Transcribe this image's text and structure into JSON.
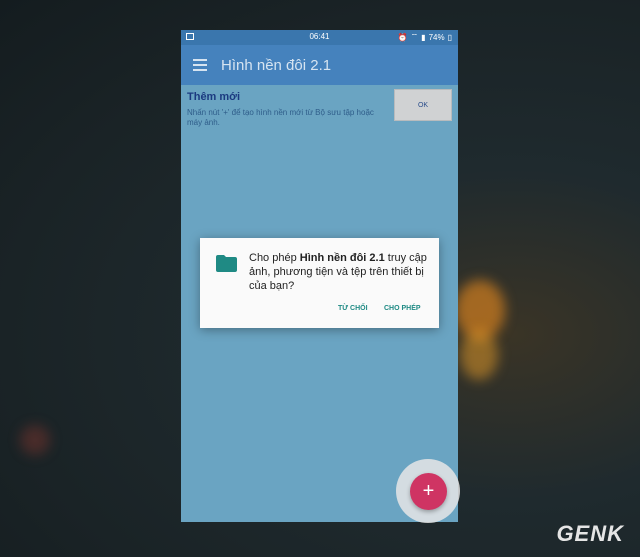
{
  "status_bar": {
    "time": "06:41",
    "battery": "74%"
  },
  "app_bar": {
    "title": "Hình nền đôi 2.1"
  },
  "content": {
    "title": "Thêm mới",
    "description": "Nhấn nút '+' để tạo hình nền mới từ Bộ sưu tập hoặc máy ảnh.",
    "ok_label": "OK"
  },
  "dialog": {
    "message_prefix": "Cho phép ",
    "app_name": "Hình nền đôi 2.1",
    "message_suffix": " truy cập ảnh, phương tiện và tệp trên thiết bị của bạn?",
    "deny_label": "TỪ CHỐI",
    "allow_label": "CHO PHÉP"
  },
  "fab": {
    "label": "+"
  },
  "watermark": {
    "text": "GENK"
  },
  "colors": {
    "app_bar": "#4582bd",
    "dialog_button": "#1f8a84",
    "fab": "#cf3463",
    "folder_icon": "#1f8a84"
  }
}
